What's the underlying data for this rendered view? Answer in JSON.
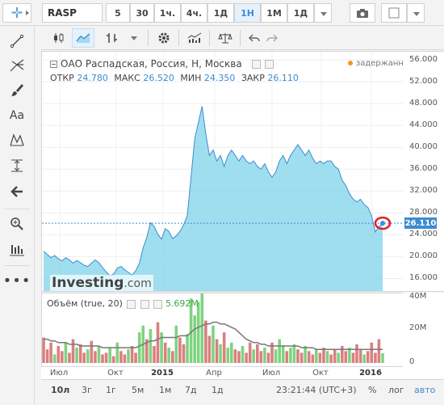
{
  "toolbar": {
    "symbol": "RASP",
    "intervals": [
      {
        "label": "5",
        "active": false
      },
      {
        "label": "30",
        "active": false
      },
      {
        "label": "1ч.",
        "active": false
      },
      {
        "label": "4ч.",
        "active": false
      },
      {
        "label": "1Д",
        "active": false
      },
      {
        "label": "1Н",
        "active": true
      },
      {
        "label": "1М",
        "active": false
      },
      {
        "label": "1Д",
        "active": false
      }
    ]
  },
  "left_tools": [
    "crosshair-icon",
    "trend-line-icon",
    "pitchfork-icon",
    "brush-icon",
    "text-tool-icon",
    "pattern-icon",
    "measure-icon",
    "arrow-left-icon",
    "zoom-icon",
    "bar-pattern-icon",
    "more-icon"
  ],
  "chart_header": {
    "title": "ОАО Распадская, Россия, Н, Москва",
    "delayed_label": "задержанные",
    "ohlc": [
      {
        "label": "ОТКР",
        "value": "24.780"
      },
      {
        "label": "МАКС",
        "value": "26.520"
      },
      {
        "label": "МИН",
        "value": "24.350"
      },
      {
        "label": "ЗАКР",
        "value": "26.110"
      }
    ]
  },
  "watermark": {
    "brand": "Investing",
    "suffix": ".com"
  },
  "price_axis": {
    "ticks": [
      "56.000",
      "52.000",
      "48.000",
      "44.000",
      "40.000",
      "36.000",
      "32.000",
      "28.000",
      "24.000",
      "20.000",
      "16.000"
    ],
    "current_price": "26.110",
    "current_value": 26.11
  },
  "volume": {
    "legend_label": "Объём (true, 20)",
    "legend_value": "5.692M",
    "axis_ticks": [
      "40M",
      "20M",
      "0"
    ]
  },
  "time_axis": {
    "labels": [
      {
        "text": "Июл",
        "bold": false
      },
      {
        "text": "Окт",
        "bold": false
      },
      {
        "text": "2015",
        "bold": true
      },
      {
        "text": "Апр",
        "bold": false
      },
      {
        "text": "Июл",
        "bold": false
      },
      {
        "text": "Окт",
        "bold": false
      },
      {
        "text": "2016",
        "bold": true
      }
    ]
  },
  "bottom_bar": {
    "ranges": [
      "10л",
      "3г",
      "1г",
      "5м",
      "1м",
      "7д",
      "1д"
    ],
    "clock": "23:21:44 (UTC+3)",
    "percent_label": "%",
    "log_label": "лог",
    "auto_label": "авто"
  },
  "chart_data": {
    "type": "area",
    "ylim": [
      14,
      56
    ],
    "price_series": [
      21.0,
      20.4,
      19.8,
      20.2,
      19.6,
      19.2,
      19.8,
      19.4,
      18.8,
      19.3,
      18.9,
      18.4,
      18.2,
      18.8,
      19.4,
      18.9,
      18.0,
      17.2,
      16.5,
      16.8,
      17.9,
      18.2,
      17.6,
      17.1,
      16.6,
      17.4,
      18.8,
      21.6,
      23.5,
      26.2,
      25.5,
      24.1,
      23.2,
      25.1,
      24.6,
      23.3,
      23.8,
      24.6,
      25.8,
      27.5,
      34.5,
      41.5,
      44.5,
      47.5,
      42.5,
      38.5,
      39.5,
      37.5,
      38.5,
      36.5,
      38.5,
      39.5,
      38.5,
      37.5,
      38.5,
      37.5,
      37.0,
      37.5,
      36.5,
      36.0,
      37.0,
      35.5,
      34.5,
      35.5,
      37.5,
      38.5,
      37.0,
      38.5,
      39.5,
      40.5,
      39.5,
      38.5,
      39.5,
      38.0,
      37.0,
      37.5,
      37.0,
      37.5,
      37.5,
      36.5,
      36.0,
      34.0,
      33.0,
      31.5,
      30.5,
      30.0,
      30.5,
      29.5,
      29.0,
      27.5,
      24.5,
      25.5,
      26.11
    ],
    "volume_series": [
      {
        "v": 15,
        "up": false
      },
      {
        "v": 8,
        "up": false
      },
      {
        "v": 12,
        "up": false
      },
      {
        "v": 5,
        "up": true
      },
      {
        "v": 10,
        "up": false
      },
      {
        "v": 7,
        "up": false
      },
      {
        "v": 12,
        "up": true
      },
      {
        "v": 6,
        "up": false
      },
      {
        "v": 14,
        "up": false
      },
      {
        "v": 9,
        "up": true
      },
      {
        "v": 11,
        "up": false
      },
      {
        "v": 6,
        "up": false
      },
      {
        "v": 8,
        "up": true
      },
      {
        "v": 13,
        "up": false
      },
      {
        "v": 7,
        "up": false
      },
      {
        "v": 10,
        "up": true
      },
      {
        "v": 5,
        "up": false
      },
      {
        "v": 6,
        "up": false
      },
      {
        "v": 9,
        "up": true
      },
      {
        "v": 4,
        "up": false
      },
      {
        "v": 12,
        "up": true
      },
      {
        "v": 7,
        "up": false
      },
      {
        "v": 5,
        "up": false
      },
      {
        "v": 8,
        "up": true
      },
      {
        "v": 10,
        "up": false
      },
      {
        "v": 6,
        "up": false
      },
      {
        "v": 18,
        "up": true
      },
      {
        "v": 22,
        "up": true
      },
      {
        "v": 14,
        "up": false
      },
      {
        "v": 20,
        "up": true
      },
      {
        "v": 10,
        "up": false
      },
      {
        "v": 24,
        "up": false
      },
      {
        "v": 18,
        "up": true
      },
      {
        "v": 12,
        "up": false
      },
      {
        "v": 9,
        "up": true
      },
      {
        "v": 7,
        "up": false
      },
      {
        "v": 22,
        "up": true
      },
      {
        "v": 15,
        "up": false
      },
      {
        "v": 11,
        "up": false
      },
      {
        "v": 17,
        "up": true
      },
      {
        "v": 38,
        "up": true
      },
      {
        "v": 28,
        "up": true
      },
      {
        "v": 36,
        "up": true
      },
      {
        "v": 42,
        "up": true
      },
      {
        "v": 25,
        "up": false
      },
      {
        "v": 16,
        "up": false
      },
      {
        "v": 22,
        "up": true
      },
      {
        "v": 14,
        "up": false
      },
      {
        "v": 11,
        "up": true
      },
      {
        "v": 18,
        "up": false
      },
      {
        "v": 9,
        "up": true
      },
      {
        "v": 12,
        "up": true
      },
      {
        "v": 8,
        "up": false
      },
      {
        "v": 7,
        "up": false
      },
      {
        "v": 10,
        "up": true
      },
      {
        "v": 6,
        "up": false
      },
      {
        "v": 12,
        "up": false
      },
      {
        "v": 8,
        "up": true
      },
      {
        "v": 11,
        "up": false
      },
      {
        "v": 7,
        "up": false
      },
      {
        "v": 9,
        "up": true
      },
      {
        "v": 6,
        "up": false
      },
      {
        "v": 12,
        "up": false
      },
      {
        "v": 8,
        "up": true
      },
      {
        "v": 14,
        "up": true
      },
      {
        "v": 10,
        "up": true
      },
      {
        "v": 7,
        "up": false
      },
      {
        "v": 9,
        "up": true
      },
      {
        "v": 11,
        "up": true
      },
      {
        "v": 8,
        "up": false
      },
      {
        "v": 6,
        "up": false
      },
      {
        "v": 10,
        "up": true
      },
      {
        "v": 7,
        "up": false
      },
      {
        "v": 5,
        "up": false
      },
      {
        "v": 8,
        "up": true
      },
      {
        "v": 6,
        "up": false
      },
      {
        "v": 9,
        "up": false
      },
      {
        "v": 7,
        "up": true
      },
      {
        "v": 5,
        "up": false
      },
      {
        "v": 8,
        "up": false
      },
      {
        "v": 6,
        "up": true
      },
      {
        "v": 10,
        "up": false
      },
      {
        "v": 7,
        "up": false
      },
      {
        "v": 9,
        "up": true
      },
      {
        "v": 6,
        "up": false
      },
      {
        "v": 11,
        "up": false
      },
      {
        "v": 8,
        "up": false
      },
      {
        "v": 5,
        "up": true
      },
      {
        "v": 7,
        "up": false
      },
      {
        "v": 12,
        "up": false
      },
      {
        "v": 6,
        "up": false
      },
      {
        "v": 14,
        "up": false
      },
      {
        "v": 5.692,
        "up": true
      }
    ],
    "volume_ma": [
      14,
      14,
      13,
      13,
      12,
      12,
      12,
      11,
      11,
      11,
      10,
      10,
      10,
      10,
      10,
      10,
      9,
      9,
      9,
      9,
      9,
      9,
      9,
      9,
      9,
      9,
      10,
      11,
      12,
      13,
      13,
      14,
      15,
      15,
      15,
      15,
      15,
      16,
      16,
      16,
      18,
      20,
      21,
      22,
      23,
      23,
      24,
      24,
      23,
      23,
      22,
      21,
      20,
      18,
      16,
      14,
      13,
      12,
      12,
      11,
      11,
      10,
      10,
      10,
      10,
      10,
      10,
      10,
      10,
      10,
      9,
      9,
      9,
      9,
      8,
      8,
      8,
      8,
      8,
      8,
      8,
      8,
      8,
      8,
      8,
      8,
      8,
      8,
      8,
      8,
      8,
      8,
      8
    ],
    "colors": {
      "line": "#3d8cd1",
      "area": "#7fd3e8",
      "vol_up": "#7fd37f",
      "vol_down": "#d98080",
      "ma": "#777777",
      "marker": "#e51c23"
    }
  }
}
